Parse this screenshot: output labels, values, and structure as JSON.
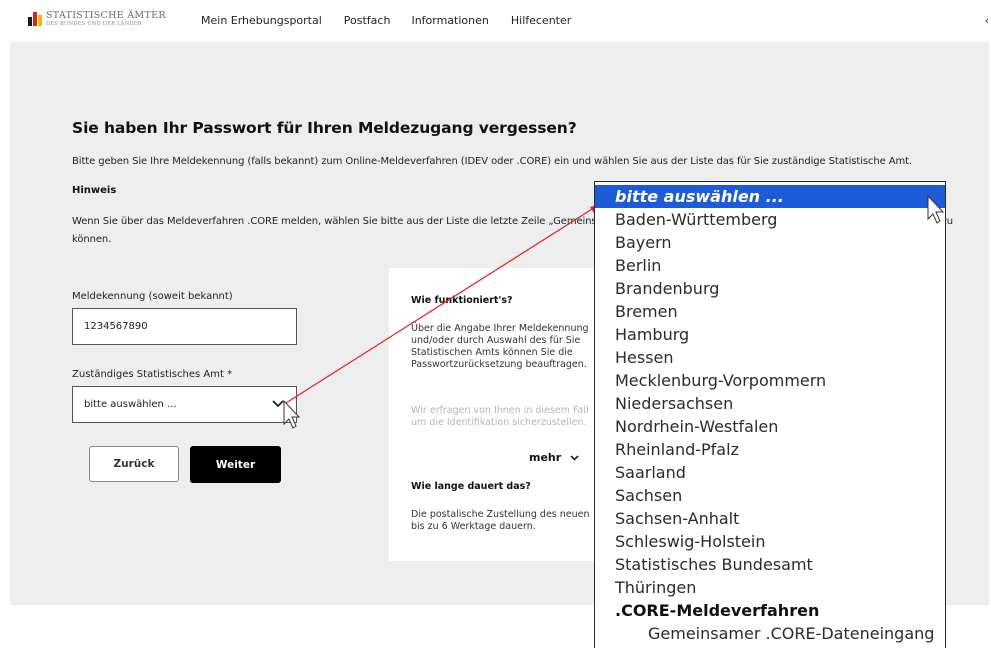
{
  "header": {
    "logo_line1": "STATISTISCHE ÄMTER",
    "logo_line2": "DES BUNDES UND DER LÄNDER",
    "nav": [
      "Mein Erhebungsportal",
      "Postfach",
      "Informationen",
      "Hilfecenter"
    ],
    "right_glyph": "‹"
  },
  "page": {
    "title": "Sie haben Ihr Passwort für Ihren Meldezugang vergessen?",
    "intro": "Bitte geben Sie Ihre Meldekennung (falls bekannt) zum Online-Meldeverfahren (IDEV oder .CORE) ein und wählen Sie aus der Liste das für Sie zuständige Statistische Amt.",
    "hint_title": "Hinweis",
    "hint_text": "Wenn Sie über das Meldeverfahren .CORE melden, wählen Sie bitte aus der Liste die letzte Zeile „Gemeinsamer .CORE-Dateneingang“ aus, um Ihren Auftrag korrekt bearbeiten zu können."
  },
  "form": {
    "id_label": "Meldekennung (soweit bekannt)",
    "id_value": "1234567890",
    "office_label": "Zuständiges Statistisches Amt *",
    "office_value": "bitte auswählen ...",
    "back_label": "Zurück",
    "next_label": "Weiter"
  },
  "info_card": {
    "heading1": "Wie funktioniert's?",
    "para1": "Über die Angabe Ihrer Meldekennung\nund/oder durch Auswahl des für Sie\nStatistischen Amts können Sie die\nPasswortzurücksetzung beauftragen.",
    "para1_faded": "Wir erfragen von Ihnen in diesem Fall\num die Identifikation sicherzustellen.",
    "more_label": "mehr",
    "heading2": "Wie lange dauert das?",
    "para2": "Die postalische Zustellung des neuen\nbis zu 6 Werktage dauern."
  },
  "dropdown": {
    "selected": "bitte auswählen ...",
    "options": [
      "Baden-Württemberg",
      "Bayern",
      "Berlin",
      "Brandenburg",
      "Bremen",
      "Hamburg",
      "Hessen",
      "Mecklenburg-Vorpommern",
      "Niedersachsen",
      "Nordrhein-Westfalen",
      "Rheinland-Pfalz",
      "Saarland",
      "Sachsen",
      "Sachsen-Anhalt",
      "Schleswig-Holstein",
      "Statistisches Bundesamt",
      "Thüringen"
    ],
    "group_label": ".CORE-Meldeverfahren",
    "group_option": "Gemeinsamer .CORE-Dateneingang"
  },
  "colors": {
    "selection": "#1e5bd8",
    "annotation_arrow": "#e02020",
    "panel_bg": "#eeeeee"
  }
}
